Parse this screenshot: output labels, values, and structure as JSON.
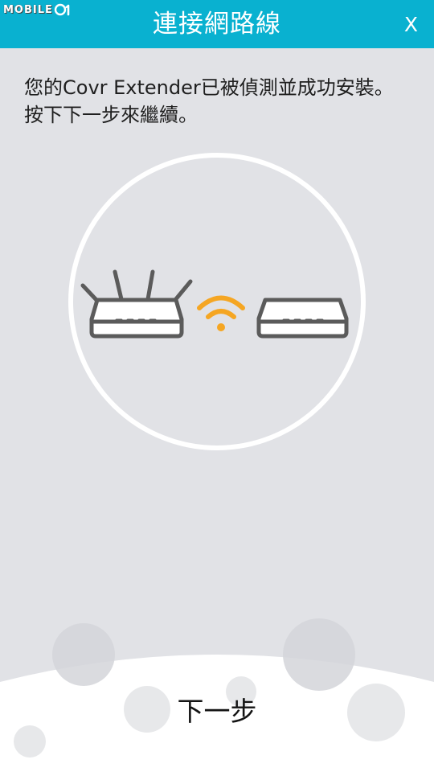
{
  "header": {
    "title": "連接網路線",
    "close_label": "X",
    "color": "#09b1d0"
  },
  "watermark": {
    "text": "MOBILE"
  },
  "message": {
    "text": "您的Covr Extender已被偵測並成功安裝。按下下一步來繼續。"
  },
  "illustration": {
    "icons": [
      "router-icon",
      "wifi-icon",
      "extender-icon"
    ],
    "wifi_color": "#f5a623",
    "device_color": "#5b5b5b"
  },
  "footer": {
    "next_label": "下一步"
  }
}
